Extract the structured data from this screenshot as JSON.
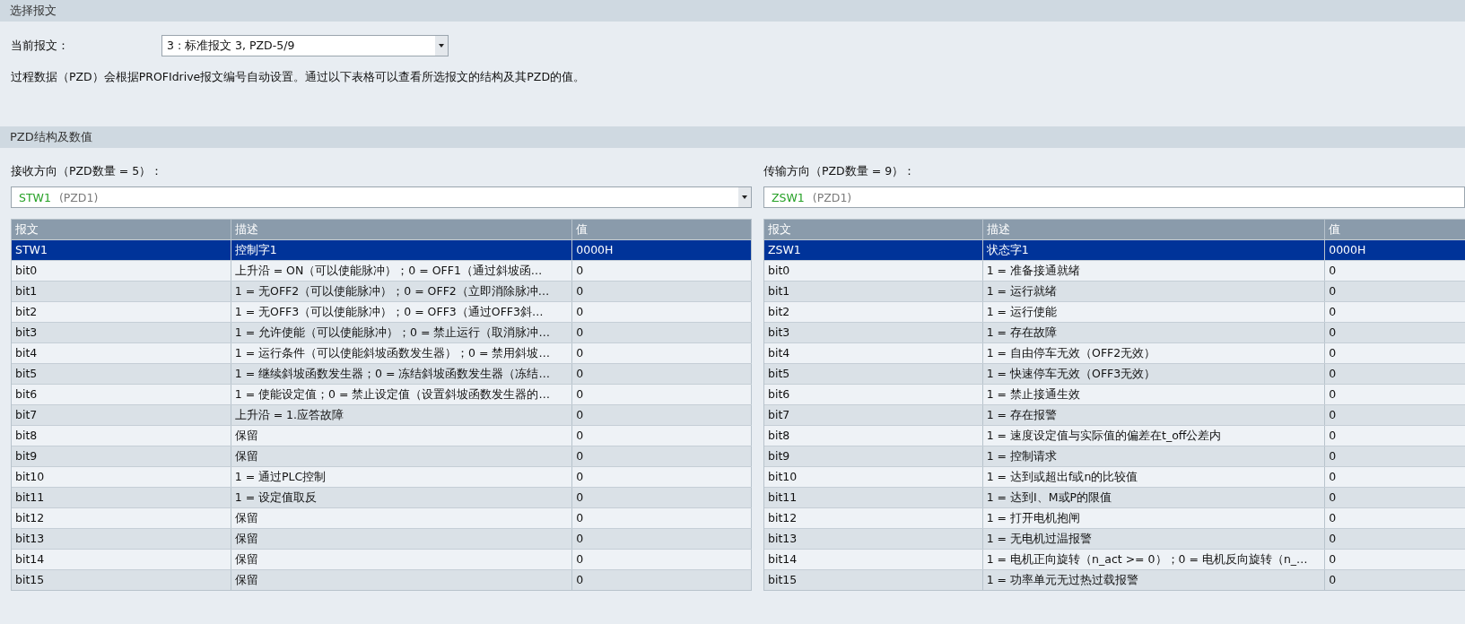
{
  "telegram_section": {
    "title": "选择报文",
    "current_label": "当前报文：",
    "current_value": "3 : 标准报文 3, PZD-5/9",
    "description": "过程数据（PZD）会根据PROFIdrive报文编号自动设置。通过以下表格可以查看所选报文的结构及其PZD的值。"
  },
  "pzd_section": {
    "title": "PZD结构及数值"
  },
  "panels": [
    {
      "label": "接收方向（PZD数量 = 5）：",
      "selector": {
        "name": "STW1",
        "pzd": "(PZD1)",
        "has_dropdown": true
      },
      "columns": [
        "报文",
        "描述",
        "值"
      ],
      "rows": [
        {
          "cells": [
            "STW1",
            "控制字1",
            "0000H"
          ],
          "selected": true
        },
        {
          "cells": [
            "bit0",
            "上升沿 = ON（可以使能脉冲）；0 = OFF1（通过斜坡函…",
            "0"
          ],
          "selected": false
        },
        {
          "cells": [
            "bit1",
            "1 = 无OFF2（可以使能脉冲）；0 = OFF2（立即消除脉冲…",
            "0"
          ],
          "selected": false
        },
        {
          "cells": [
            "bit2",
            "1 = 无OFF3（可以使能脉冲）；0 = OFF3（通过OFF3斜…",
            "0"
          ],
          "selected": false
        },
        {
          "cells": [
            "bit3",
            "1 = 允许使能（可以使能脉冲）；0 = 禁止运行（取消脉冲…",
            "0"
          ],
          "selected": false
        },
        {
          "cells": [
            "bit4",
            "1 = 运行条件（可以使能斜坡函数发生器）；0 = 禁用斜坡…",
            "0"
          ],
          "selected": false
        },
        {
          "cells": [
            "bit5",
            "1 = 继续斜坡函数发生器；0 = 冻结斜坡函数发生器（冻结…",
            "0"
          ],
          "selected": false
        },
        {
          "cells": [
            "bit6",
            "1 = 使能设定值；0 = 禁止设定值（设置斜坡函数发生器的…",
            "0"
          ],
          "selected": false
        },
        {
          "cells": [
            "bit7",
            "上升沿 = 1.应答故障",
            "0"
          ],
          "selected": false
        },
        {
          "cells": [
            "bit8",
            "保留",
            "0"
          ],
          "selected": false
        },
        {
          "cells": [
            "bit9",
            "保留",
            "0"
          ],
          "selected": false
        },
        {
          "cells": [
            "bit10",
            "1 = 通过PLC控制",
            "0"
          ],
          "selected": false
        },
        {
          "cells": [
            "bit11",
            "1 = 设定值取反",
            "0"
          ],
          "selected": false
        },
        {
          "cells": [
            "bit12",
            "保留",
            "0"
          ],
          "selected": false
        },
        {
          "cells": [
            "bit13",
            "保留",
            "0"
          ],
          "selected": false
        },
        {
          "cells": [
            "bit14",
            "保留",
            "0"
          ],
          "selected": false
        },
        {
          "cells": [
            "bit15",
            "保留",
            "0"
          ],
          "selected": false
        }
      ]
    },
    {
      "label": "传输方向（PZD数量 = 9）：",
      "selector": {
        "name": "ZSW1",
        "pzd": "(PZD1)",
        "has_dropdown": false
      },
      "columns": [
        "报文",
        "描述",
        "值"
      ],
      "rows": [
        {
          "cells": [
            "ZSW1",
            "状态字1",
            "0000H"
          ],
          "selected": true
        },
        {
          "cells": [
            "bit0",
            "1 = 准备接通就绪",
            "0"
          ],
          "selected": false
        },
        {
          "cells": [
            "bit1",
            "1 = 运行就绪",
            "0"
          ],
          "selected": false
        },
        {
          "cells": [
            "bit2",
            "1 = 运行使能",
            "0"
          ],
          "selected": false
        },
        {
          "cells": [
            "bit3",
            "1 = 存在故障",
            "0"
          ],
          "selected": false
        },
        {
          "cells": [
            "bit4",
            "1 = 自由停车无效（OFF2无效）",
            "0"
          ],
          "selected": false
        },
        {
          "cells": [
            "bit5",
            "1 = 快速停车无效（OFF3无效）",
            "0"
          ],
          "selected": false
        },
        {
          "cells": [
            "bit6",
            "1 = 禁止接通生效",
            "0"
          ],
          "selected": false
        },
        {
          "cells": [
            "bit7",
            "1 = 存在报警",
            "0"
          ],
          "selected": false
        },
        {
          "cells": [
            "bit8",
            "1 = 速度设定值与实际值的偏差在t_off公差内",
            "0"
          ],
          "selected": false
        },
        {
          "cells": [
            "bit9",
            "1 = 控制请求",
            "0"
          ],
          "selected": false
        },
        {
          "cells": [
            "bit10",
            "1 = 达到或超出f或n的比较值",
            "0"
          ],
          "selected": false
        },
        {
          "cells": [
            "bit11",
            "1 = 达到I、M或P的限值",
            "0"
          ],
          "selected": false
        },
        {
          "cells": [
            "bit12",
            "1 = 打开电机抱闸",
            "0"
          ],
          "selected": false
        },
        {
          "cells": [
            "bit13",
            "1 = 无电机过温报警",
            "0"
          ],
          "selected": false
        },
        {
          "cells": [
            "bit14",
            "1 = 电机正向旋转（n_act >= 0）；0 = 电机反向旋转（n_…",
            "0"
          ],
          "selected": false
        },
        {
          "cells": [
            "bit15",
            "1 = 功率单元无过热过载报警",
            "0"
          ],
          "selected": false
        }
      ]
    }
  ]
}
